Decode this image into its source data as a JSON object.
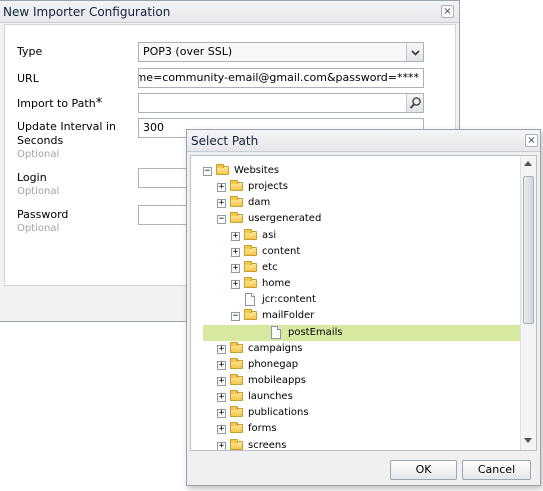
{
  "main_dialog": {
    "title": "New Importer Configuration",
    "close_symbol": "×",
    "fields": {
      "type": {
        "label": "Type",
        "value": "POP3 (over SSL)"
      },
      "url": {
        "label": "URL",
        "value": "?username=community-email@gmail.com&password=****"
      },
      "import_path": {
        "label": "Import to Path",
        "required_mark": "*",
        "value": ""
      },
      "interval": {
        "label_line1": "Update Interval in",
        "label_line2": "Seconds",
        "hint": "Optional",
        "value": "300"
      },
      "login": {
        "label": "Login",
        "hint": "Optional",
        "value": ""
      },
      "password": {
        "label": "Password",
        "hint": "Optional",
        "value": ""
      }
    }
  },
  "select_path_dialog": {
    "title": "Select Path",
    "close_symbol": "×",
    "tree": [
      {
        "label": "Websites",
        "toggle": "−",
        "icon": "folder-icon"
      },
      {
        "label": "projects",
        "toggle": "+",
        "icon": "folder-icon"
      },
      {
        "label": "dam",
        "toggle": "+",
        "icon": "folder-icon"
      },
      {
        "label": "usergenerated",
        "toggle": "−",
        "icon": "folder-icon"
      },
      {
        "label": "asi",
        "toggle": "+",
        "icon": "folder-icon"
      },
      {
        "label": "content",
        "toggle": "+",
        "icon": "folder-icon"
      },
      {
        "label": "etc",
        "toggle": "+",
        "icon": "folder-icon"
      },
      {
        "label": "home",
        "toggle": "+",
        "icon": "folder-icon"
      },
      {
        "label": "jcr:content",
        "toggle": "",
        "icon": "page-icon"
      },
      {
        "label": "mailFolder",
        "toggle": "−",
        "icon": "folder-icon"
      },
      {
        "label": "postEmails",
        "toggle": "",
        "icon": "page-icon",
        "selected": true
      },
      {
        "label": "campaigns",
        "toggle": "+",
        "icon": "folder-icon"
      },
      {
        "label": "phonegap",
        "toggle": "+",
        "icon": "folder-icon"
      },
      {
        "label": "mobileapps",
        "toggle": "+",
        "icon": "folder-icon"
      },
      {
        "label": "launches",
        "toggle": "+",
        "icon": "folder-icon"
      },
      {
        "label": "publications",
        "toggle": "+",
        "icon": "folder-icon"
      },
      {
        "label": "forms",
        "toggle": "+",
        "icon": "folder-icon"
      },
      {
        "label": "screens",
        "toggle": "+",
        "icon": "folder-icon"
      }
    ],
    "ok_label": "OK",
    "cancel_label": "Cancel",
    "selection_color": "#d7e8a1"
  }
}
